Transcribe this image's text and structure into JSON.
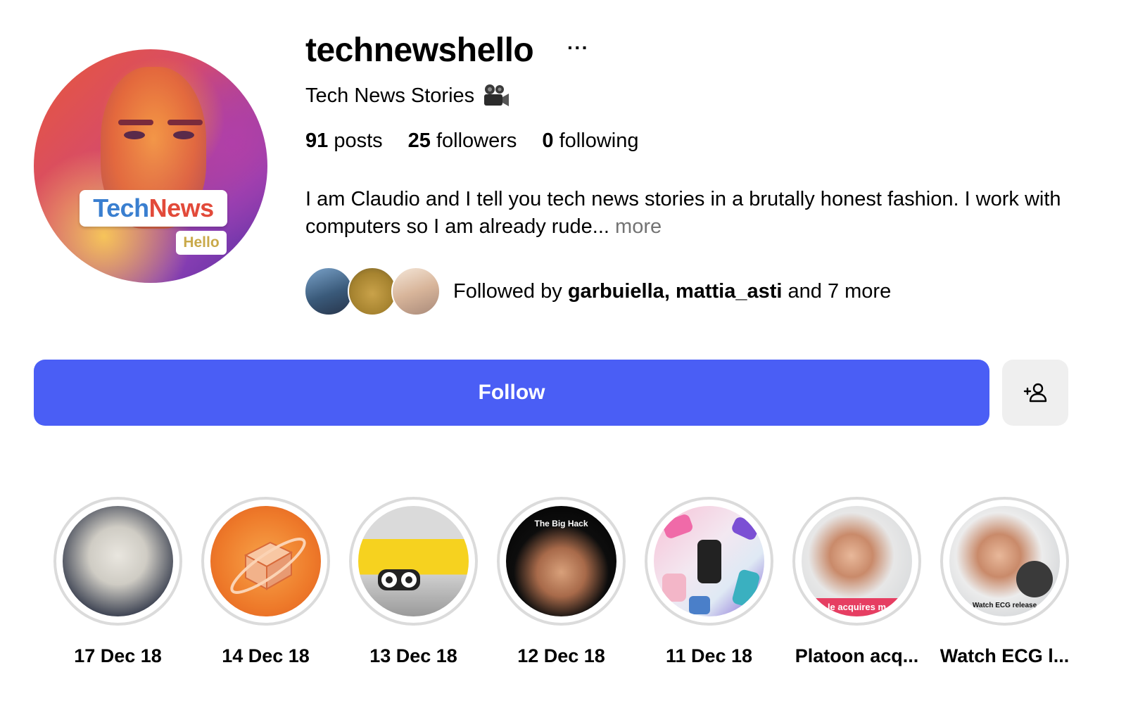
{
  "profile": {
    "username": "technewshello",
    "more_options": "···",
    "full_name": "Tech News Stories",
    "avatar_badge": {
      "text1": "Tech",
      "text2": "News",
      "sub": "Hello"
    },
    "stats": {
      "posts_count": "91",
      "posts_label": "posts",
      "followers_count": "25",
      "followers_label": "followers",
      "following_count": "0",
      "following_label": "following"
    },
    "bio": "I am Claudio and I tell you tech news stories in a brutally honest fashion. I work with computers so I am already rude...",
    "bio_more": "more",
    "followed_by": {
      "prefix": "Followed by",
      "user1": "garbuiella",
      "sep": ",",
      "user2": "mattia_asti",
      "suffix": "and 7 more"
    }
  },
  "actions": {
    "follow_label": "Follow",
    "suggest_icon": "add-person-icon"
  },
  "highlights": [
    {
      "label": "17 Dec 18",
      "caption": ""
    },
    {
      "label": "14 Dec 18",
      "caption": ""
    },
    {
      "label": "13 Dec 18",
      "caption": ""
    },
    {
      "label": "12 Dec 18",
      "caption": "The Big Hack"
    },
    {
      "label": "11 Dec 18",
      "caption": ""
    },
    {
      "label": "Platoon acq...",
      "caption": "le acquires m"
    },
    {
      "label": "Watch ECG l...",
      "caption": "Watch ECG release"
    }
  ],
  "colors": {
    "follow_button": "#4a5ef5",
    "secondary_button": "#efefef",
    "ring": "#dbdbdb",
    "muted_text": "#737373"
  }
}
